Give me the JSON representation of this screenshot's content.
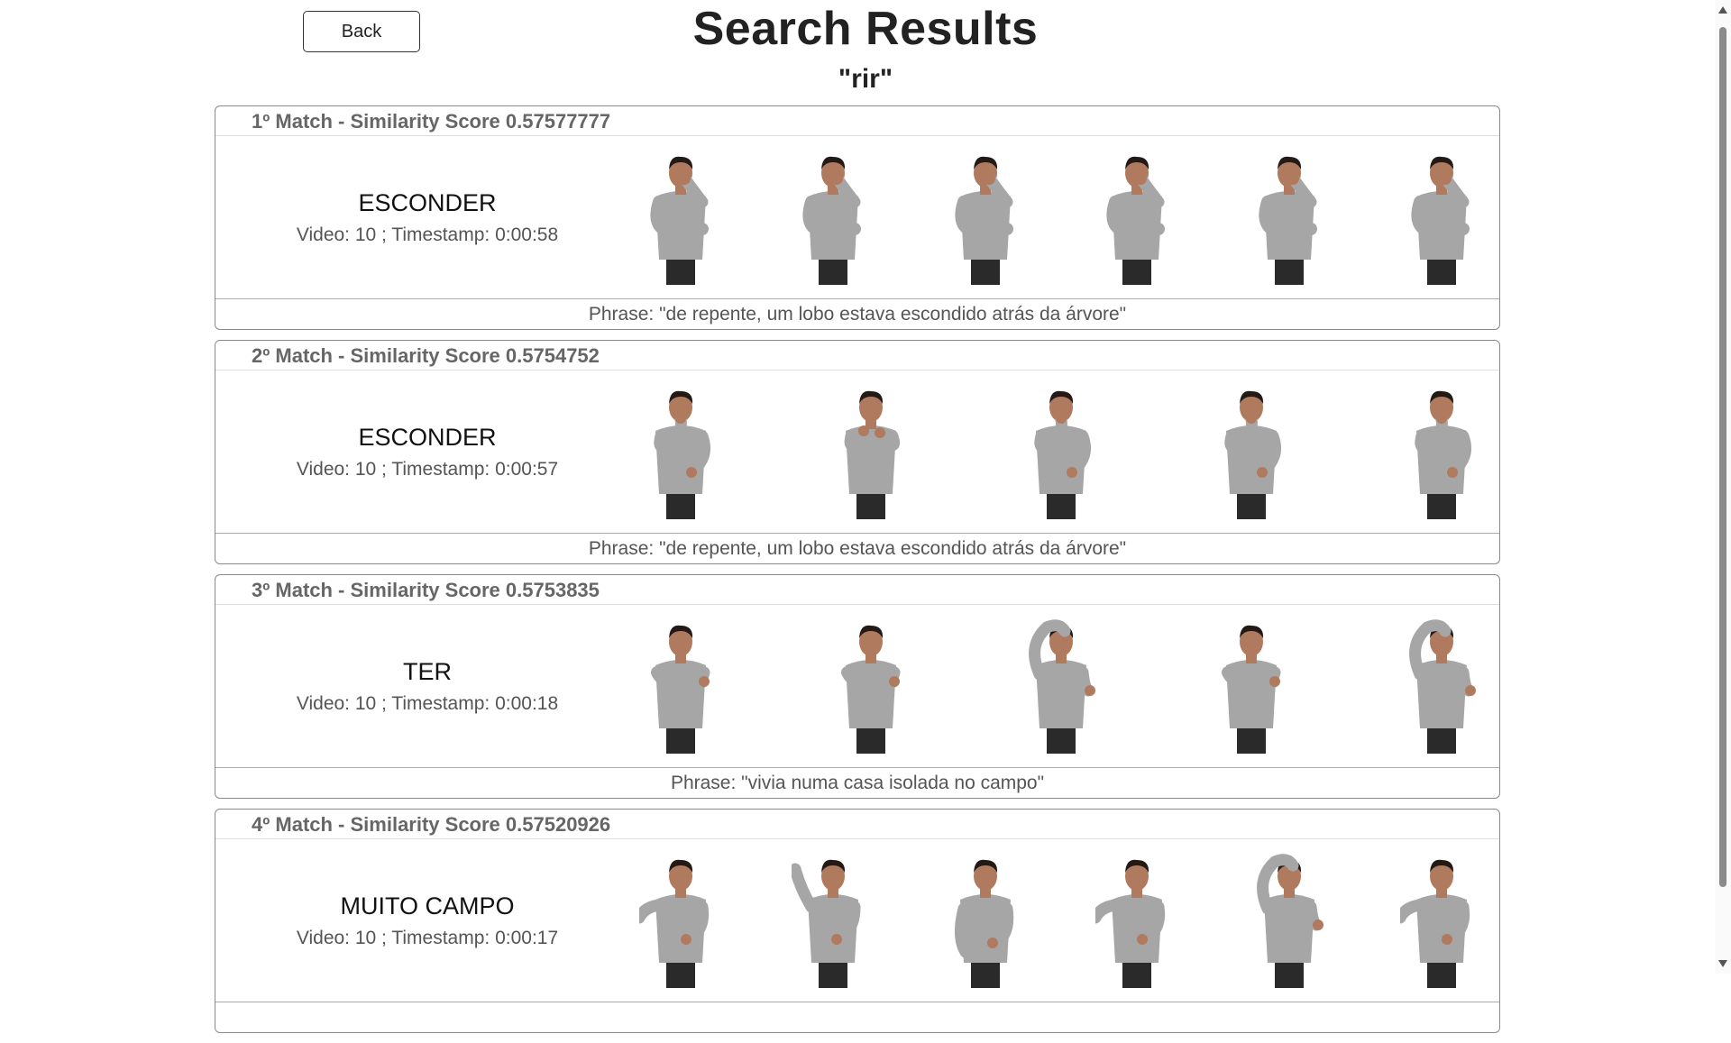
{
  "header": {
    "back_label": "Back",
    "title": "Search Results",
    "query": "\"rir\""
  },
  "results": [
    {
      "header": "1º Match - Similarity Score 0.57577777",
      "gloss": "ESCONDER",
      "video_info": "Video: 10 ; Timestamp: 0:00:58",
      "phrase": "Phrase: \"de repente, um lobo estava escondido atrás da árvore\"",
      "frames": [
        "hand-to-face",
        "hand-to-face",
        "hand-to-face",
        "hand-to-face",
        "hand-to-face",
        "hand-to-face"
      ]
    },
    {
      "header": "2º Match - Similarity Score 0.5754752",
      "gloss": "ESCONDER",
      "video_info": "Video: 10 ; Timestamp: 0:00:57",
      "phrase": "Phrase: \"de repente, um lobo estava escondido atrás da árvore\"",
      "frames": [
        "hand-to-mouth",
        "fists-raised",
        "hand-to-mouth",
        "hand-to-mouth",
        "hand-to-mouth"
      ]
    },
    {
      "header": "3º Match - Similarity Score 0.5753835",
      "gloss": "TER",
      "video_info": "Video: 10 ; Timestamp: 0:00:18",
      "phrase": "Phrase: \"vivia numa casa isolada no campo\"",
      "frames": [
        "arms-crossed",
        "arms-crossed",
        "arm-over-head",
        "arms-crossed",
        "arm-over-head"
      ]
    },
    {
      "header": "4º Match - Similarity Score 0.57520926",
      "gloss": "MUITO CAMPO",
      "video_info": "Video: 10 ; Timestamp: 0:00:17",
      "phrase": "",
      "frames": [
        "arm-extended",
        "arm-raised",
        "hands-low",
        "arm-extended",
        "arm-over-head",
        "arm-extended"
      ]
    }
  ],
  "colors": {
    "header_text": "#666666",
    "shirt": "#a6a6a6",
    "skin": "#b07a5e",
    "hair": "#231a16",
    "pants": "#2a2a2a"
  }
}
